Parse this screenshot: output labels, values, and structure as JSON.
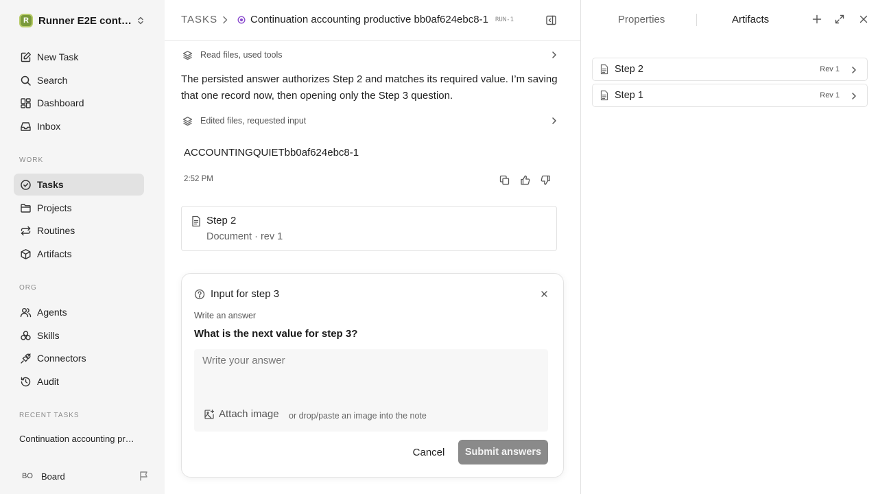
{
  "sidebar": {
    "workspace": {
      "logo_letter": "R",
      "name": "Runner E2E continuation"
    },
    "nav": [
      {
        "label": "New Task",
        "icon": "edit-icon"
      },
      {
        "label": "Search",
        "icon": "search-icon"
      },
      {
        "label": "Dashboard",
        "icon": "dashboard-icon"
      },
      {
        "label": "Inbox",
        "icon": "inbox-icon"
      }
    ],
    "work_label": "WORK",
    "work": [
      {
        "label": "Tasks",
        "icon": "check-circle-icon",
        "active": true
      },
      {
        "label": "Projects",
        "icon": "folder-icon"
      },
      {
        "label": "Routines",
        "icon": "repeat-icon"
      },
      {
        "label": "Artifacts",
        "icon": "box-icon"
      }
    ],
    "org_label": "ORG",
    "org": [
      {
        "label": "Agents",
        "icon": "users-icon"
      },
      {
        "label": "Skills",
        "icon": "skills-icon"
      },
      {
        "label": "Connectors",
        "icon": "plug-icon"
      },
      {
        "label": "Audit",
        "icon": "history-icon"
      }
    ],
    "recent_label": "RECENT TASKS",
    "recent_tasks": [
      "Continuation accounting productive bb0af624ebc8-1"
    ],
    "user": {
      "initials": "BO",
      "name": "Board"
    }
  },
  "main": {
    "breadcrumb_root": "TASKS",
    "task_title": "Continuation accounting productive bb0af624ebc8-1",
    "run_badge": "RUN-1",
    "activity_1": "Read files, used tools",
    "message": "The persisted answer authorizes Step 2 and matches its required value. I’m saving that one record now, then opening only the Step 3 question.",
    "activity_2": "Edited files, requested input",
    "code_line": "ACCOUNTINGQUIETbb0af624ebc8-1",
    "timestamp": "2:52 PM",
    "artifact_card": {
      "title": "Step 2",
      "subtitle": "Document · rev 1"
    },
    "input_card": {
      "title": "Input for step 3",
      "hint": "Write an answer",
      "question": "What is the next value for step 3?",
      "placeholder": "Write your answer",
      "attach_label": "Attach image",
      "drop_hint": "or drop/paste an image into the note",
      "cancel_label": "Cancel",
      "submit_label": "Submit answers"
    }
  },
  "right_panel": {
    "tabs": [
      "Properties",
      "Artifacts"
    ],
    "active_tab": "Artifacts",
    "artifacts": [
      {
        "name": "Step 2",
        "rev": "Rev 1"
      },
      {
        "name": "Step 1",
        "rev": "Rev 1"
      }
    ]
  },
  "colors": {
    "sidebar_bg": "#f5f5f5",
    "active_nav_bg": "#e2e2e2",
    "status_purple": "#8b4ccf",
    "submit_disabled": "#8a8a8a",
    "logo_green": "#7a9a3a"
  }
}
